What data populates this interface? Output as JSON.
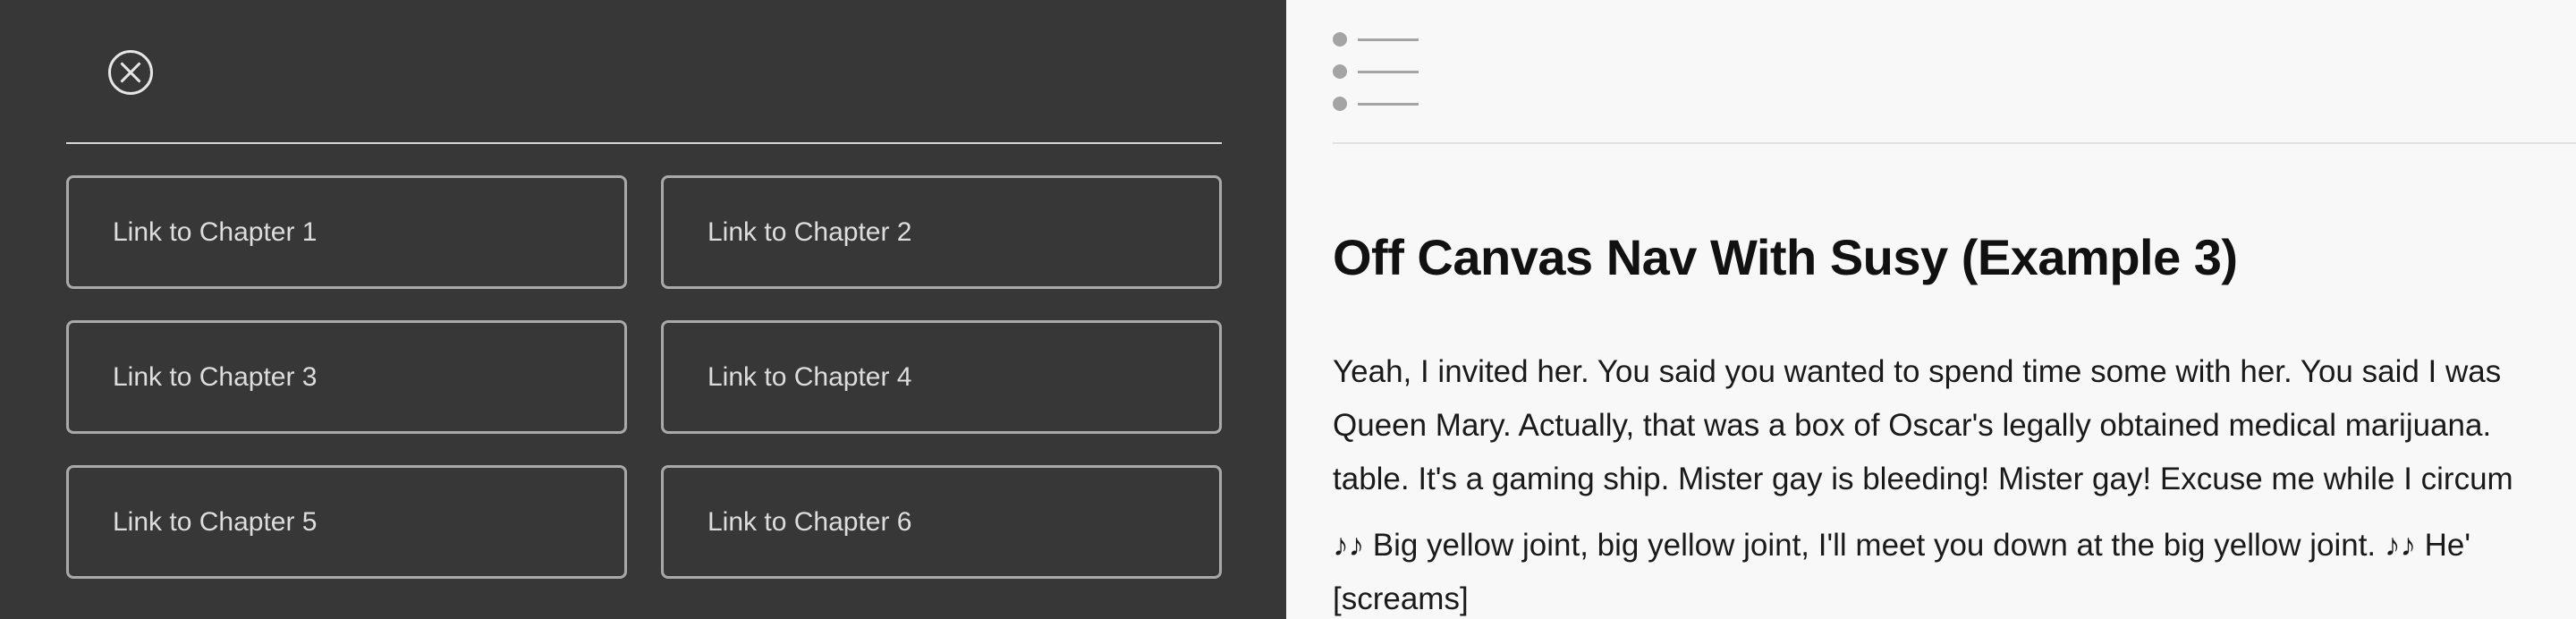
{
  "nav": {
    "links": [
      {
        "label": "Link to Chapter 1"
      },
      {
        "label": "Link to Chapter 2"
      },
      {
        "label": "Link to Chapter 3"
      },
      {
        "label": "Link to Chapter 4"
      },
      {
        "label": "Link to Chapter 5"
      },
      {
        "label": "Link to Chapter 6"
      }
    ]
  },
  "main": {
    "title": "Off Canvas Nav With Susy (Example 3)",
    "paragraph1": [
      "Yeah, I invited her. You said you wanted to spend time some with her. You said I was",
      "Queen Mary. Actually, that was a box of Oscar's legally obtained medical marijuana.",
      "table. It's a gaming ship. Mister gay is bleeding! Mister gay! Excuse me while I circum"
    ],
    "paragraph2": [
      "♪♪ Big yellow joint, big yellow joint, I'll meet you down at the big yellow joint. ♪♪ He'",
      "[screams]"
    ]
  },
  "icons": {
    "close": "close-circle-icon",
    "menu": "bullet-list-icon"
  },
  "colors": {
    "nav_background": "#373737",
    "main_background": "#f8f8f8",
    "link_border": "#a9a9a9",
    "icon_gray": "#a4a4a4"
  }
}
